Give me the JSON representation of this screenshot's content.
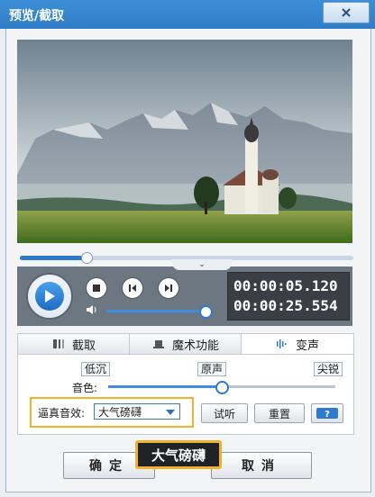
{
  "window": {
    "title": "预览/截取"
  },
  "player": {
    "progress": 0.2,
    "current_time": "00:00:05.120",
    "total_time": "00:00:25.554",
    "volume": 0.93
  },
  "tabs": [
    {
      "label": "截取",
      "icon": "trim-icon",
      "active": false
    },
    {
      "label": "魔术功能",
      "icon": "magic-hat-icon",
      "active": false
    },
    {
      "label": "变声",
      "icon": "waveform-icon",
      "active": true
    }
  ],
  "voice": {
    "level_low": "低沉",
    "level_mid": "原声",
    "level_high": "尖锐",
    "tone_label": "音色:",
    "tone_value": 0.5,
    "effect_label": "逼真音效:",
    "effect_selected": "大气磅礴",
    "preview_button": "试听",
    "reset_button": "重置"
  },
  "footer": {
    "ok_button": "确定",
    "cancel_button": "取消"
  },
  "tooltip": {
    "text": "大气磅礴"
  },
  "colors": {
    "accent": "#2e7ad1",
    "highlight": "#f3b12b",
    "titlebar": "#3c8fd8"
  }
}
